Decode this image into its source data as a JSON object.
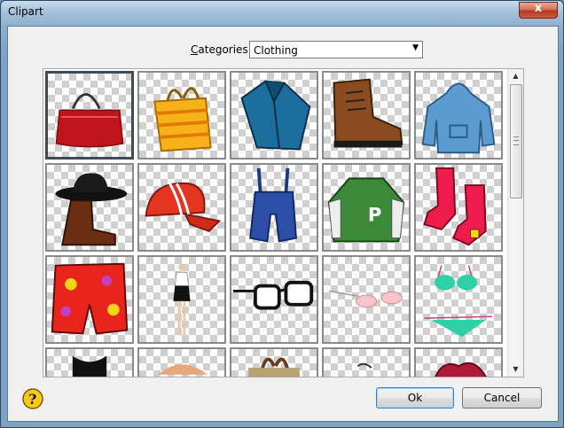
{
  "window": {
    "title": "Clipart",
    "close_symbol": "x"
  },
  "categories": {
    "label_prefix": "C",
    "label_rest": "ategories",
    "selected": "Clothing"
  },
  "grid": {
    "items": [
      {
        "icon": "red-handbag-icon"
      },
      {
        "icon": "orange-tote-bag-icon"
      },
      {
        "icon": "blue-shirt-icon"
      },
      {
        "icon": "brown-boot-icon"
      },
      {
        "icon": "blue-hoodie-icon"
      },
      {
        "icon": "cowboy-hat-boot-icon"
      },
      {
        "icon": "red-cap-icon"
      },
      {
        "icon": "blue-overalls-icon"
      },
      {
        "icon": "green-jacket-icon"
      },
      {
        "icon": "red-socks-icon"
      },
      {
        "icon": "swim-shorts-icon"
      },
      {
        "icon": "dress-mannequin-icon"
      },
      {
        "icon": "black-glasses-icon"
      },
      {
        "icon": "pink-glasses-icon"
      },
      {
        "icon": "bikini-icon"
      },
      {
        "icon": "black-top-icon"
      },
      {
        "icon": "hat-icon"
      },
      {
        "icon": "bag-icon"
      },
      {
        "icon": "sunglasses-icon"
      },
      {
        "icon": "gloves-icon"
      }
    ]
  },
  "buttons": {
    "ok": "Ok",
    "cancel": "Cancel"
  },
  "colors": {
    "title_bar": "#8fb0cd",
    "close_button": "#c84a2e",
    "accent": "#3c7fb1"
  }
}
